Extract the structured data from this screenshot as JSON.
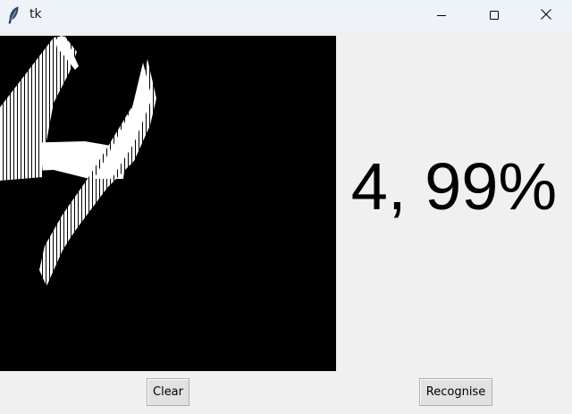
{
  "window": {
    "title": "tk",
    "icon": "feather-icon",
    "controls": [
      "minimize-icon",
      "maximize-icon",
      "close-icon"
    ]
  },
  "canvas": {
    "background": "#000000",
    "stroke_color": "#ffffff",
    "content": "handwritten-digit-drawing"
  },
  "result": {
    "text": "4, 99%"
  },
  "buttons": {
    "clear_label": "Clear",
    "recognise_label": "Recognise"
  }
}
